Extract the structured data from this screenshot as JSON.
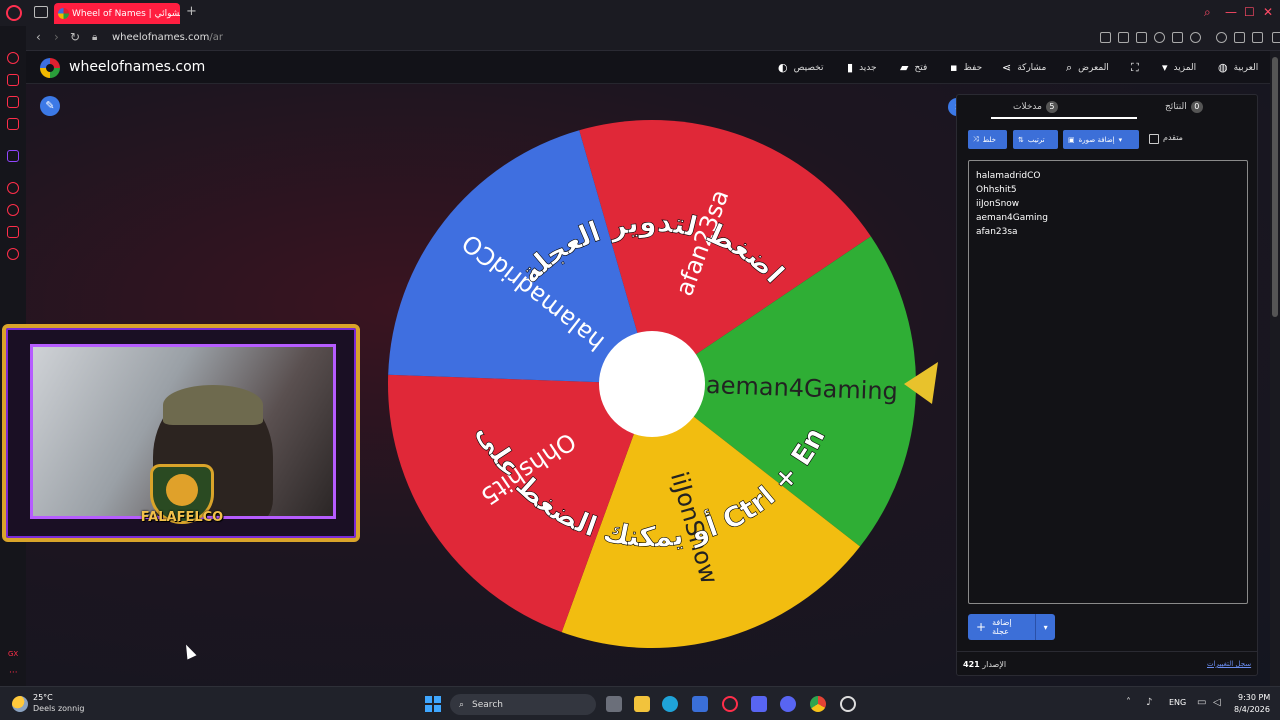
{
  "browser": {
    "tab_title": "Wheel of Names | العشوائي",
    "new_tab": "+",
    "url_host": "wheelofnames.com",
    "url_path": "/ar",
    "controls": {
      "minimize": "—",
      "maximize": "☐",
      "close": "✕"
    }
  },
  "site": {
    "name": "wheelofnames.com",
    "menu": [
      {
        "label": "تخصيص",
        "icon": "palette-icon"
      },
      {
        "label": "جديد",
        "icon": "file-icon"
      },
      {
        "label": "فتح",
        "icon": "folder-icon"
      },
      {
        "label": "حفظ",
        "icon": "save-icon"
      },
      {
        "label": "مشاركة",
        "icon": "share-icon"
      },
      {
        "label": "المعرض",
        "icon": "search-icon"
      },
      {
        "label": "",
        "icon": "fullscreen-icon"
      },
      {
        "label": "المزيد",
        "icon": "caret-down-icon"
      },
      {
        "label": "العربية",
        "icon": "globe-icon"
      }
    ]
  },
  "wheel": {
    "segments": [
      {
        "name": "afan23sa",
        "color": "#e02838"
      },
      {
        "name": "aeman4Gaming",
        "color": "#2fae35"
      },
      {
        "name": "iiJonSnow",
        "color": "#f2bd10"
      },
      {
        "name": "Ohhshit5",
        "color": "#e02838"
      },
      {
        "name": "halamadridCO",
        "color": "#3f6fe0"
      }
    ],
    "instruction_top": "اضغط لتدوير العجلة",
    "instruction_bottom": "أو يمكنك الضغط على زر Ctrl + Enter",
    "pointer_color": "#e8c22c"
  },
  "overlay": {
    "badge_text": "FALAFELCO",
    "frame_color": "#d9a42a",
    "accent_color": "#b65cff"
  },
  "panel": {
    "tabs": [
      {
        "label": "مدخلات",
        "count": "5"
      },
      {
        "label": "النتائج",
        "count": "0"
      }
    ],
    "tools": {
      "shuffle": "خلط",
      "sort": "ترتيب",
      "add_image": "إضافة صورة",
      "advanced": "متقدم"
    },
    "entries": [
      "halamadridCO",
      "Ohhshit5",
      "iiJonSnow",
      "aeman4Gaming",
      "afan23sa"
    ],
    "add_wheel": "إضافة عجلة",
    "version_label": "الإصدار",
    "version_number": "421",
    "changelog": "سجل التغييرات"
  },
  "taskbar": {
    "weather_temp": "25°C",
    "weather_desc": "Deels zonnig",
    "search": "Search",
    "lang": "ENG",
    "time": "9:30 PM",
    "date": "8/4/2026"
  },
  "colors": {
    "accent": "#3c6fd8",
    "opera_red": "#ff1e40"
  }
}
